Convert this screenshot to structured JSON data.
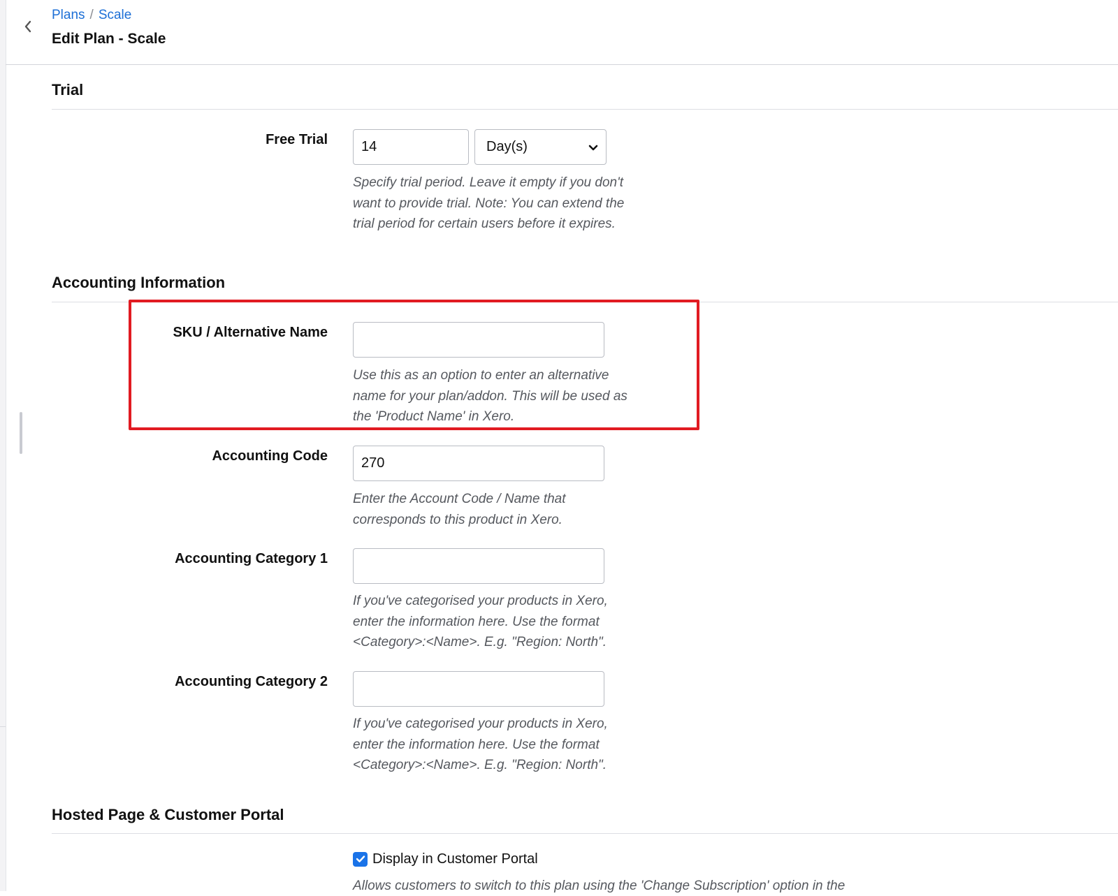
{
  "breadcrumb": {
    "item1": "Plans",
    "separator": "/",
    "item2": "Scale"
  },
  "page_title": "Edit Plan - Scale",
  "trial": {
    "section_title": "Trial",
    "free_trial_label": "Free Trial",
    "free_trial_value": "14",
    "unit_selected": "Day(s)",
    "help_lines": [
      "Specify trial period. Leave it empty if you don't",
      "want to provide trial. Note: You can extend the",
      "trial period for certain users before it expires."
    ]
  },
  "accounting": {
    "section_title": "Accounting Information",
    "sku": {
      "label": "SKU / Alternative Name",
      "value": "",
      "help_lines": [
        "Use this as an option to enter an alternative",
        "name for your plan/addon. This will be used as",
        "the 'Product Name' in Xero."
      ]
    },
    "code": {
      "label": "Accounting Code",
      "value": "270",
      "help_lines": [
        "Enter the Account Code / Name that",
        "corresponds to this product in Xero."
      ]
    },
    "category1": {
      "label": "Accounting Category 1",
      "value": "",
      "help_lines": [
        "If you've categorised your products in Xero,",
        "enter the information here. Use the format",
        "<Category>:<Name>. E.g. \"Region: North\"."
      ]
    },
    "category2": {
      "label": "Accounting Category 2",
      "value": "",
      "help_lines": [
        "If you've categorised your products in Xero,",
        "enter the information here. Use the format",
        "<Category>:<Name>. E.g. \"Region: North\"."
      ]
    }
  },
  "hosted": {
    "section_title": "Hosted Page & Customer Portal",
    "display_in_portal_label": "Display in Customer Portal",
    "display_in_portal_checked": true,
    "help_partial": "Allows customers to switch to this plan using the 'Change Subscription' option in the"
  },
  "colors": {
    "link": "#1d6fd6",
    "highlight": "#e11b22",
    "checkbox": "#1a73e8",
    "help_text": "#55585e"
  }
}
